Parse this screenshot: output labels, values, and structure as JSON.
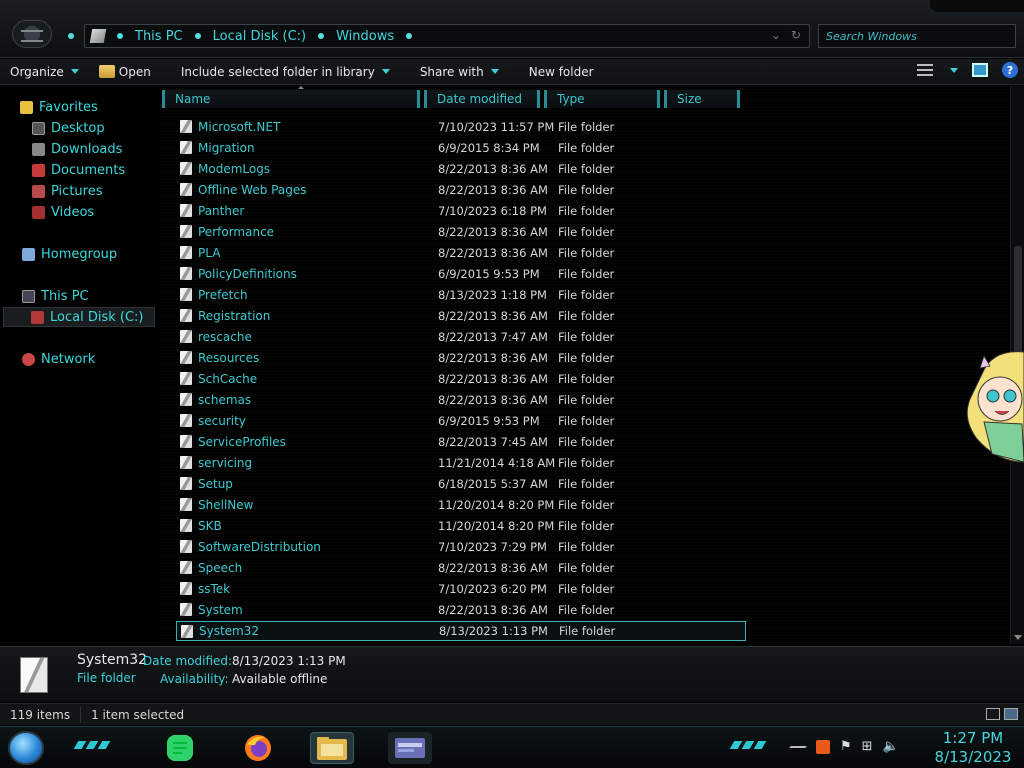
{
  "address": {
    "crumbs": [
      "This PC",
      "Local Disk (C:)",
      "Windows"
    ],
    "search_placeholder": "Search Windows"
  },
  "toolbar": {
    "organize": "Organize",
    "open": "Open",
    "include": "Include selected folder in library",
    "share": "Share with",
    "new_folder": "New folder",
    "help": "?"
  },
  "nav": {
    "favorites": "Favorites",
    "desktop": "Desktop",
    "downloads": "Downloads",
    "documents": "Documents",
    "pictures": "Pictures",
    "videos": "Videos",
    "homegroup": "Homegroup",
    "this_pc": "This PC",
    "local_disk": "Local Disk (C:)",
    "network": "Network"
  },
  "columns": [
    "Name",
    "Date modified",
    "Type",
    "Size"
  ],
  "files": [
    {
      "name": "Microsoft.NET",
      "date": "7/10/2023 11:57 PM",
      "type": "File folder"
    },
    {
      "name": "Migration",
      "date": "6/9/2015 8:34 PM",
      "type": "File folder"
    },
    {
      "name": "ModemLogs",
      "date": "8/22/2013 8:36 AM",
      "type": "File folder"
    },
    {
      "name": "Offline Web Pages",
      "date": "8/22/2013 8:36 AM",
      "type": "File folder"
    },
    {
      "name": "Panther",
      "date": "7/10/2023 6:18 PM",
      "type": "File folder"
    },
    {
      "name": "Performance",
      "date": "8/22/2013 8:36 AM",
      "type": "File folder"
    },
    {
      "name": "PLA",
      "date": "8/22/2013 8:36 AM",
      "type": "File folder"
    },
    {
      "name": "PolicyDefinitions",
      "date": "6/9/2015 9:53 PM",
      "type": "File folder"
    },
    {
      "name": "Prefetch",
      "date": "8/13/2023 1:18 PM",
      "type": "File folder"
    },
    {
      "name": "Registration",
      "date": "8/22/2013 8:36 AM",
      "type": "File folder"
    },
    {
      "name": "rescache",
      "date": "8/22/2013 7:47 AM",
      "type": "File folder"
    },
    {
      "name": "Resources",
      "date": "8/22/2013 8:36 AM",
      "type": "File folder"
    },
    {
      "name": "SchCache",
      "date": "8/22/2013 8:36 AM",
      "type": "File folder"
    },
    {
      "name": "schemas",
      "date": "8/22/2013 8:36 AM",
      "type": "File folder"
    },
    {
      "name": "security",
      "date": "6/9/2015 9:53 PM",
      "type": "File folder"
    },
    {
      "name": "ServiceProfiles",
      "date": "8/22/2013 7:45 AM",
      "type": "File folder"
    },
    {
      "name": "servicing",
      "date": "11/21/2014 4:18 AM",
      "type": "File folder"
    },
    {
      "name": "Setup",
      "date": "6/18/2015 5:37 AM",
      "type": "File folder"
    },
    {
      "name": "ShellNew",
      "date": "11/20/2014 8:20 PM",
      "type": "File folder"
    },
    {
      "name": "SKB",
      "date": "11/20/2014 8:20 PM",
      "type": "File folder"
    },
    {
      "name": "SoftwareDistribution",
      "date": "7/10/2023 7:29 PM",
      "type": "File folder"
    },
    {
      "name": "Speech",
      "date": "8/22/2013 8:36 AM",
      "type": "File folder"
    },
    {
      "name": "ssTek",
      "date": "7/10/2023 6:20 PM",
      "type": "File folder"
    },
    {
      "name": "System",
      "date": "8/22/2013 8:36 AM",
      "type": "File folder"
    },
    {
      "name": "System32",
      "date": "8/13/2023 1:13 PM",
      "type": "File folder",
      "selected": true
    }
  ],
  "details": {
    "name": "System32",
    "type": "File folder",
    "date_label": "Date modified:",
    "date_value": "8/13/2023 1:13 PM",
    "avail_label": "Availability:",
    "avail_value": "Available offline"
  },
  "status": {
    "items": "119 items",
    "selected": "1 item selected"
  },
  "clock": {
    "time": "1:27 PM",
    "date": "8/13/2023"
  },
  "colors": {
    "accent": "#3bd0d8"
  }
}
